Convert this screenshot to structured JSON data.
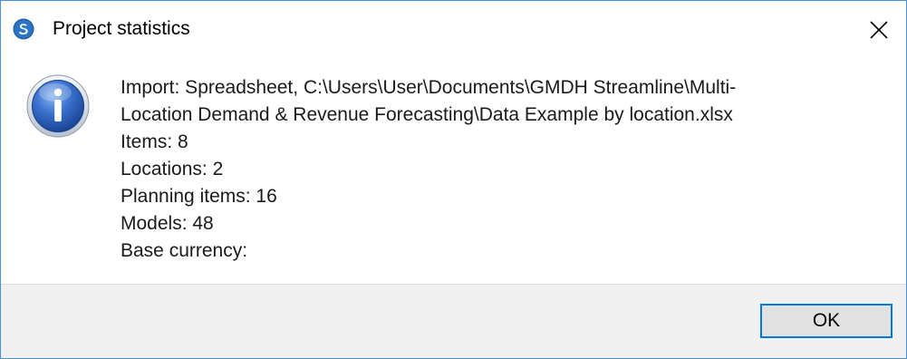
{
  "window": {
    "title": "Project statistics",
    "app_icon": "streamline-logo-icon",
    "close_icon": "close-icon"
  },
  "message": {
    "icon": "info-icon",
    "import_line_1": "Import: Spreadsheet, C:\\Users\\User\\Documents\\GMDH Streamline\\Multi-",
    "import_line_2": "Location Demand & Revenue Forecasting\\Data Example by location.xlsx",
    "items": "Items: 8",
    "locations": "Locations: 2",
    "planning_items": "Planning items: 16",
    "models": "Models: 48",
    "base_currency": "Base currency:"
  },
  "buttons": {
    "ok_label": "OK"
  },
  "colors": {
    "accent": "#0078d7",
    "border": "#4a90d9",
    "footer_bg": "#f0f0f0",
    "button_bg": "#e1e1e1"
  }
}
